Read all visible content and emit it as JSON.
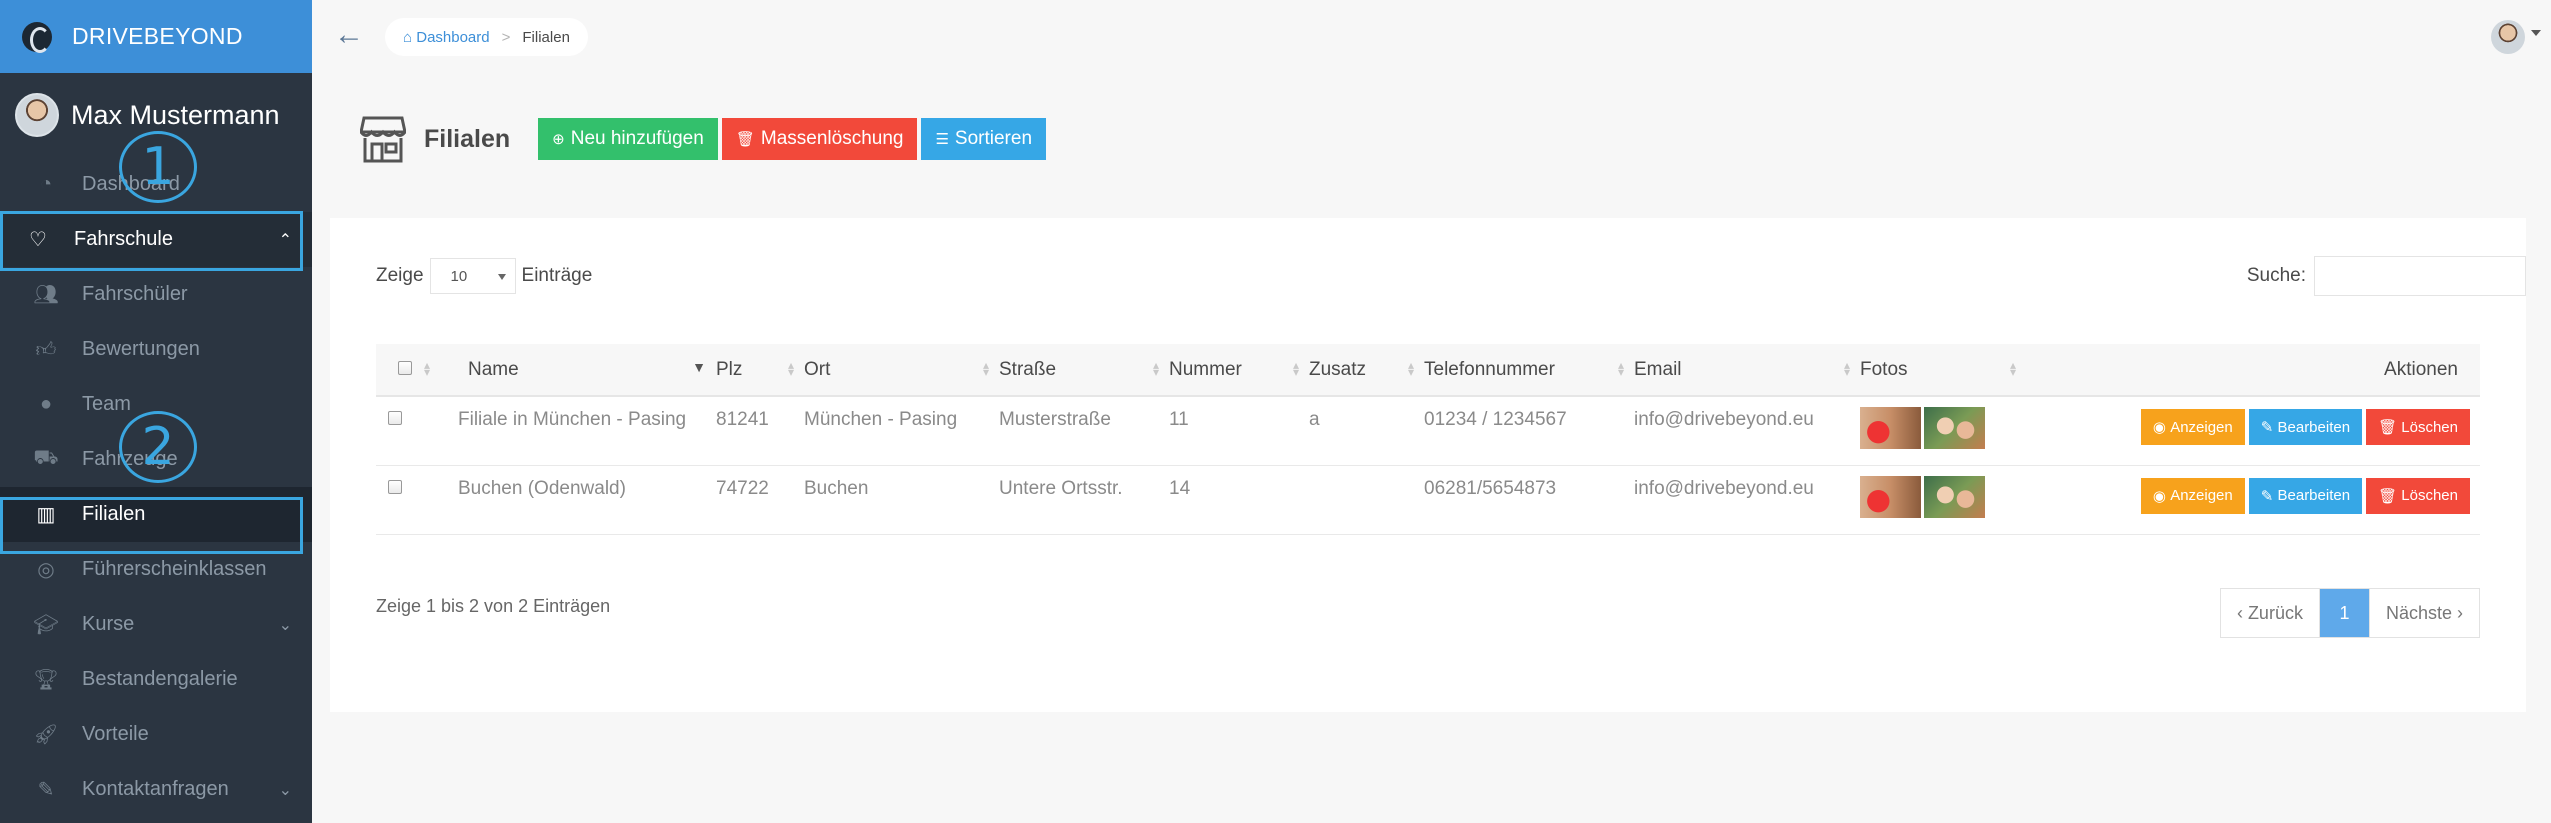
{
  "brand": {
    "name": "DRIVEBEYOND"
  },
  "user": {
    "name": "Max Mustermann"
  },
  "sidebar": {
    "items": [
      {
        "label": "Dashboard"
      },
      {
        "label": "Fahrschule"
      },
      {
        "label": "Fahrschüler"
      },
      {
        "label": "Bewertungen"
      },
      {
        "label": "Team"
      },
      {
        "label": "Fahrzeuge"
      },
      {
        "label": "Filialen"
      },
      {
        "label": "Führerscheinklassen"
      },
      {
        "label": "Kurse"
      },
      {
        "label": "Bestandengalerie"
      },
      {
        "label": "Vorteile"
      },
      {
        "label": "Kontaktanfragen"
      }
    ],
    "annotations": [
      "1",
      "2"
    ]
  },
  "breadcrumb": {
    "home": "Dashboard",
    "current": "Filialen"
  },
  "page": {
    "title": "Filialen",
    "buttons": {
      "add": "Neu hinzufügen",
      "mass_delete": "Massenlöschung",
      "sort": "Sortieren"
    }
  },
  "table_controls": {
    "show_prefix": "Zeige",
    "length_value": "10",
    "show_suffix": "Einträge",
    "search_label": "Suche:"
  },
  "table": {
    "columns": [
      "Name",
      "Plz",
      "Ort",
      "Straße",
      "Nummer",
      "Zusatz",
      "Telefonnummer",
      "Email",
      "Fotos",
      "Aktionen"
    ],
    "rows": [
      {
        "name": "Filiale in München - Pasing",
        "plz": "81241",
        "ort": "München - Pasing",
        "strasse": "Musterstraße",
        "nummer": "11",
        "zusatz": "a",
        "telefon": "01234 / 1234567",
        "email": "info@drivebeyond.eu"
      },
      {
        "name": "Buchen (Odenwald)",
        "plz": "74722",
        "ort": "Buchen",
        "strasse": "Untere Ortsstr.",
        "nummer": "14",
        "zusatz": "",
        "telefon": "06281/5654873",
        "email": "info@drivebeyond.eu"
      }
    ],
    "actions": {
      "view": "Anzeigen",
      "edit": "Bearbeiten",
      "delete": "Löschen"
    }
  },
  "footer": {
    "info": "Zeige 1 bis 2 von 2 Einträgen",
    "prev": "Zurück",
    "page": "1",
    "next": "Nächste"
  },
  "colors": {
    "sidebar": "#2b3541",
    "brand": "#3d8fd8",
    "highlight": "#3aa6e0",
    "green": "#33c06c",
    "red": "#f2493a",
    "blue": "#36a7e6",
    "orange": "#f7a21c"
  }
}
